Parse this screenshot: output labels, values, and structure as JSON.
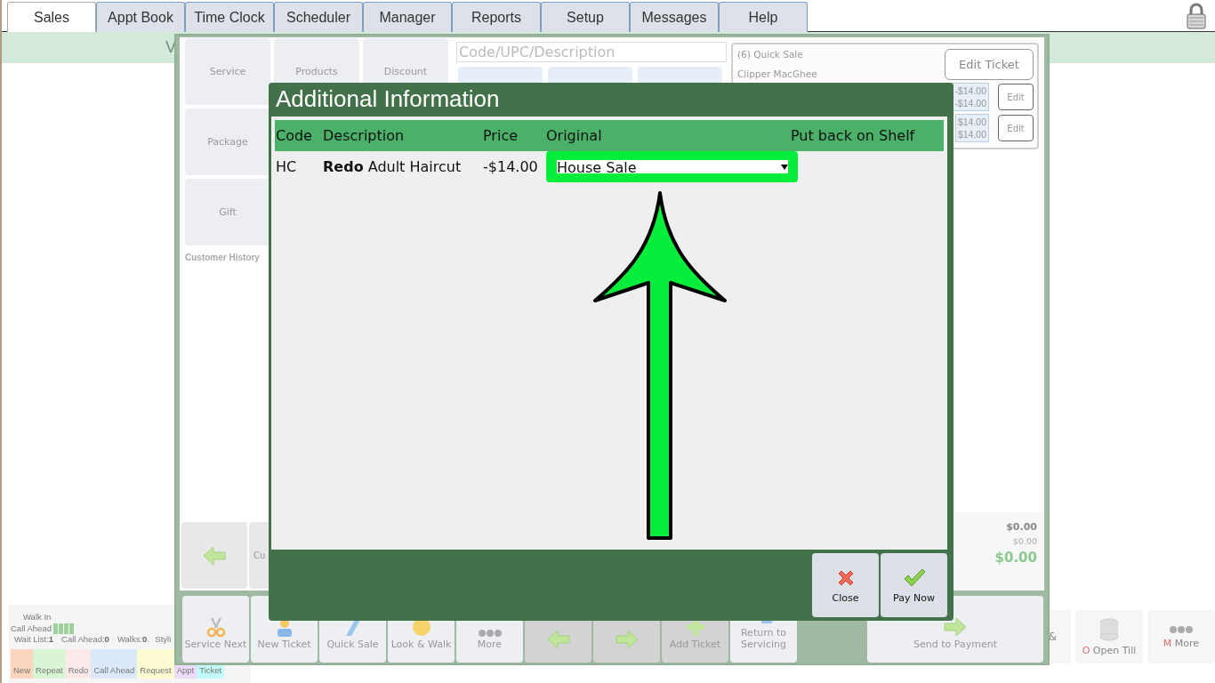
{
  "tabs": [
    {
      "label": "Sales",
      "selected": true
    },
    {
      "label": "Appt Book",
      "selected": false
    },
    {
      "label": "Time Clock",
      "selected": false
    },
    {
      "label": "Scheduler",
      "selected": false
    },
    {
      "label": "Manager",
      "selected": false
    },
    {
      "label": "Reports",
      "selected": false
    },
    {
      "label": "Setup",
      "selected": false
    },
    {
      "label": "Messages",
      "selected": false
    },
    {
      "label": "Help",
      "selected": false
    }
  ],
  "banner": {
    "text": "V"
  },
  "queue": {
    "rows": [
      {
        "label": "Walk In",
        "meter": false
      },
      {
        "label": "Call Ahead",
        "meter": true
      }
    ],
    "stats": [
      {
        "label": "Wait List:",
        "value": "1"
      },
      {
        "label": "Call Ahead:",
        "value": "0"
      },
      {
        "label": "Walks:",
        "value": "0"
      },
      {
        "label": "Styli"
      }
    ],
    "tags": [
      {
        "label": "New",
        "color": "#fbd6bc"
      },
      {
        "label": "Repeat",
        "color": "#d9f5d3"
      },
      {
        "label": "Redo",
        "color": "#fde8ea"
      },
      {
        "label": "Call Ahead",
        "color": "#dbe9fb"
      },
      {
        "label": "Request",
        "color": "#fdfbd2"
      },
      {
        "label": "Appt",
        "color": "#ecdcfb"
      },
      {
        "label": "Ticket",
        "color": "#c3fbfb"
      }
    ]
  },
  "sales": {
    "categories": [
      {
        "label": "Service"
      },
      {
        "label": "Products"
      },
      {
        "label": "Discount"
      },
      {
        "label": "Package"
      },
      {
        "label": "Gift"
      }
    ],
    "history_label": "Customer History",
    "nav_buttons": [
      {
        "kind": "arrow"
      },
      {
        "kind": "text",
        "label": "Cu"
      }
    ],
    "search": {
      "placeholder": "Code/UPC/Description"
    },
    "ticket": {
      "title": "(6) Quick Sale",
      "customer": "Clipper MacGhee",
      "edit_ticket": "Edit Ticket",
      "lines": [
        {
          "amounts": [
            "-$14.00",
            "-$14.00"
          ],
          "edit": "Edit"
        },
        {
          "amounts": [
            "$14.00",
            "$14.00"
          ],
          "edit": "Edit"
        }
      ]
    },
    "totals": {
      "subtotal": "$0.00",
      "tax": "$0.00",
      "total": "$0.00"
    },
    "toolbar": [
      {
        "label": "Service Next",
        "kind": "scissors",
        "disabled": false
      },
      {
        "label": "New Ticket",
        "kind": "person",
        "disabled": false
      },
      {
        "label": "Quick Sale",
        "kind": "bolt",
        "disabled": false
      },
      {
        "label": "Look & Walk",
        "kind": "face",
        "disabled": false
      },
      {
        "label": "More",
        "kind": "dots",
        "disabled": false
      },
      {
        "kind": "left",
        "disabled": true
      },
      {
        "kind": "right",
        "disabled": true
      },
      {
        "label": "Add Ticket",
        "kind": "plus",
        "disabled": true
      },
      {
        "label": "Return to Servicing",
        "kind": "return",
        "disabled": false
      },
      {
        "label": "Send to Payment",
        "kind": "right",
        "disabled": false,
        "wide": true
      }
    ]
  },
  "side_toolbar": [
    {
      "label": "&",
      "kind": "none"
    },
    {
      "hotkey": "O",
      "label": " Open Till",
      "kind": "database"
    },
    {
      "hotkey": "M",
      "label": " More",
      "kind": "dots"
    }
  ],
  "dialog": {
    "title": "Additional Information",
    "columns": [
      "Code",
      "Description",
      "Price",
      "Original",
      "Put back on Shelf"
    ],
    "rows": [
      {
        "code": "HC",
        "description": "**Redo** Adult Haircut",
        "price": "-$14.00",
        "original": "House Sale",
        "highlighted": true
      }
    ],
    "buttons": [
      {
        "label": "Close",
        "kind": "close"
      },
      {
        "label": "Pay Now",
        "kind": "check"
      }
    ]
  }
}
